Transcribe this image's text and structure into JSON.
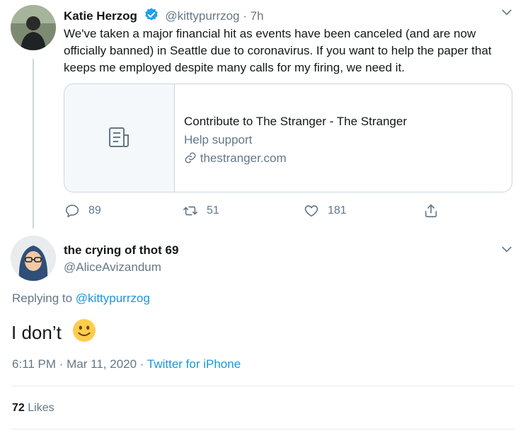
{
  "parent_tweet": {
    "author_name": "Katie Herzog",
    "handle": "@kittypurrzog",
    "time": "· 7h",
    "text": "We've taken a major financial hit as events have been canceled (and are now officially banned) in Seattle due to coronavirus. If you want to help the paper that keeps me employed despite many calls for my firing, we need it.",
    "card": {
      "title": "Contribute to The Stranger - The Stranger",
      "description": "Help support",
      "domain": "thestranger.com",
      "icon": "document-icon"
    },
    "actions": {
      "replies": "89",
      "retweets": "51",
      "likes": "181"
    }
  },
  "main_tweet": {
    "author_name": "the crying of thot 69",
    "handle": "@AliceAvizandum",
    "replying_label": "Replying to",
    "replying_handle": "@kittypurrzog",
    "text": "I don’t",
    "emoji": "slightly-smiling-face",
    "timestamp": "6:11 PM · Mar 11, 2020 ·",
    "source": "Twitter for iPhone",
    "likes_count": "72",
    "likes_label": "Likes"
  },
  "colors": {
    "accent": "#1b95e0",
    "muted": "#657786",
    "border": "#ccd6dd",
    "verified": "#1da1f2"
  }
}
